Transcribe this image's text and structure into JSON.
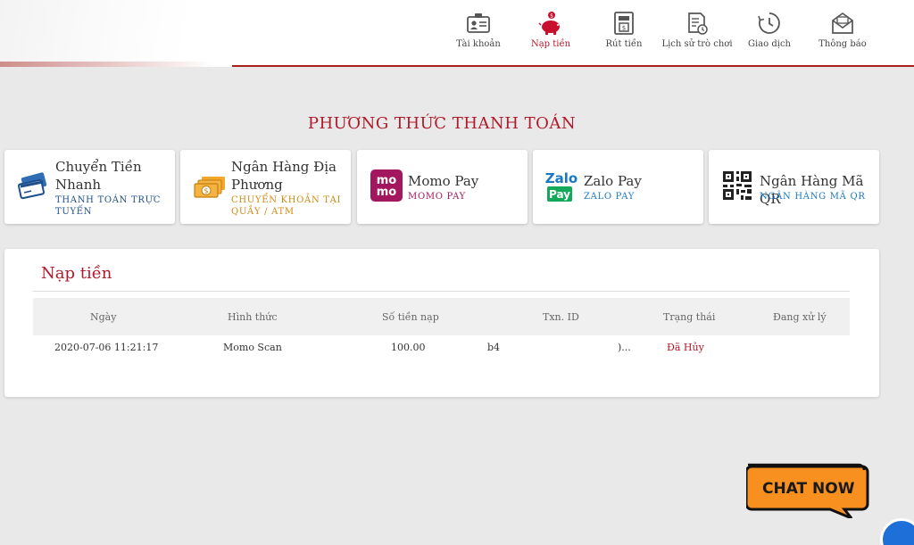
{
  "nav": {
    "items": [
      {
        "label": "Tài khoản",
        "icon": "id-card-icon"
      },
      {
        "label": "Nạp tiền",
        "icon": "piggy-bank-icon"
      },
      {
        "label": "Rút tiền",
        "icon": "atm-withdraw-icon"
      },
      {
        "label": "Lịch sử trò chơi",
        "icon": "game-history-icon"
      },
      {
        "label": "Giao dịch",
        "icon": "clock-icon"
      },
      {
        "label": "Thông báo",
        "icon": "envelope-icon"
      }
    ],
    "active_index": 1
  },
  "payment": {
    "title": "PHƯƠNG THỨC THANH TOÁN",
    "methods": [
      {
        "title": "Chuyển Tiền Nhanh",
        "subtitle": "THANH TOÁN TRỰC TUYẾN",
        "icon": "cards-icon",
        "subtitle_color": "#1d4f8c"
      },
      {
        "title": "Ngân Hàng Địa Phương",
        "subtitle": "CHUYỂN KHOẢN TẠI QUẦY / ATM",
        "icon": "cash-icon",
        "subtitle_color": "#d08a14"
      },
      {
        "title": "Momo Pay",
        "subtitle": "MOMO PAY",
        "icon": "momo-logo-icon",
        "subtitle_color": "#a3175f"
      },
      {
        "title": "Zalo Pay",
        "subtitle": "ZALO PAY",
        "icon": "zalopay-logo-icon",
        "subtitle_color": "#1a78c2"
      },
      {
        "title": "Ngân Hàng Mã QR",
        "subtitle": "NGÂN HÀNG MÃ QR",
        "icon": "qr-code-icon",
        "subtitle_color": "#1a78c2"
      }
    ],
    "logos": {
      "momo_top": "mo",
      "momo_bottom": "mo",
      "zalo_top": "Zalo",
      "zalo_bottom": "Pay"
    }
  },
  "deposit": {
    "title": "Nạp tiền",
    "columns": [
      "Ngày",
      "Hình thức",
      "Số tiền nạp",
      "Txn. ID",
      "Trạng thái",
      "Đang xử lý"
    ],
    "rows": [
      {
        "date": "2020-07-06 11:21:17",
        "method": "Momo Scan",
        "amount": "100.00",
        "txn_a": "b4",
        "txn_b": ")...",
        "status": "Đã Hủy"
      }
    ]
  },
  "chat": {
    "label": "CHAT NOW"
  },
  "colors": {
    "accent": "#b0192a",
    "header_line": "#a8211c",
    "chat_orange": "#f7901e"
  }
}
